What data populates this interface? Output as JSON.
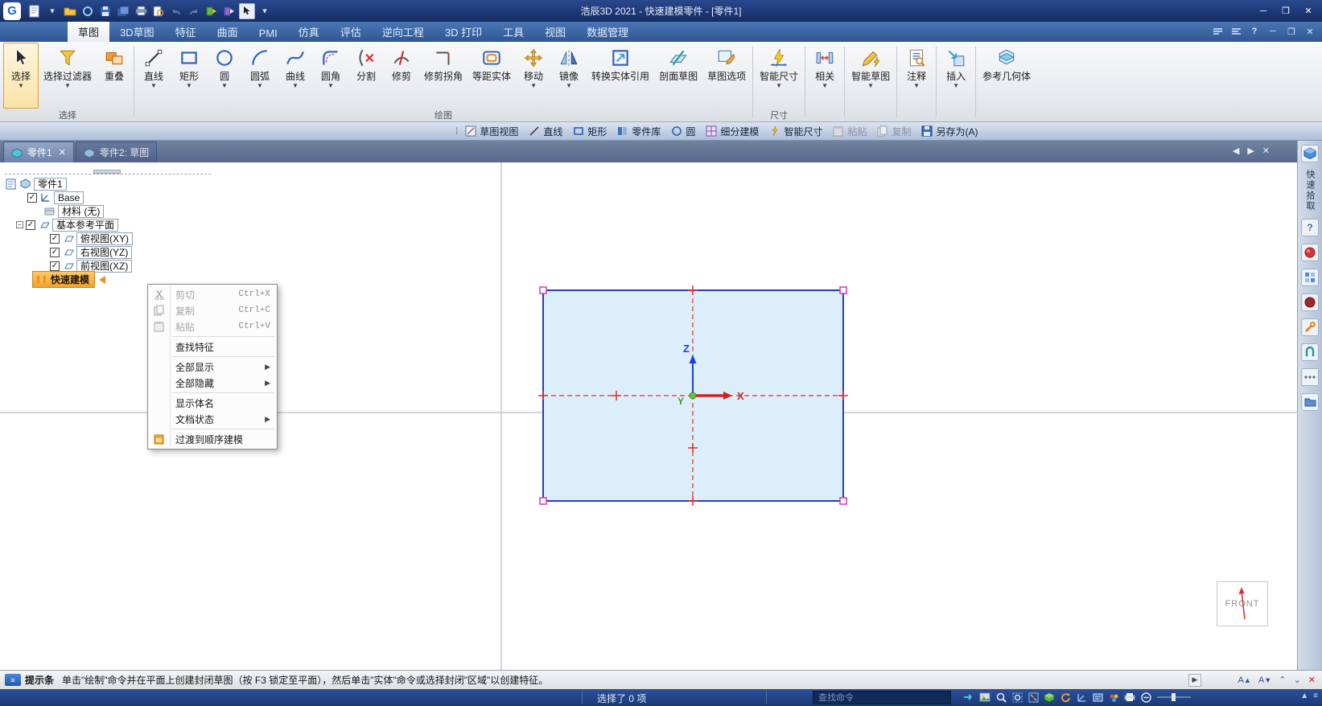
{
  "titlebar": {
    "title": "浩辰3D 2021 - 快速建模零件 - [零件1]"
  },
  "ribbon_tabs": [
    {
      "label": "草图"
    },
    {
      "label": "3D草图"
    },
    {
      "label": "特征"
    },
    {
      "label": "曲面"
    },
    {
      "label": "PMI"
    },
    {
      "label": "仿真"
    },
    {
      "label": "评估"
    },
    {
      "label": "逆向工程"
    },
    {
      "label": "3D 打印"
    },
    {
      "label": "工具"
    },
    {
      "label": "视图"
    },
    {
      "label": "数据管理"
    }
  ],
  "ribbon": {
    "select_group": {
      "label": "选择",
      "select": "选择",
      "filter": "选择过滤器",
      "overlap": "重叠"
    },
    "draw_group": {
      "label": "绘图",
      "line": "直线",
      "rect": "矩形",
      "circle": "圆",
      "arc": "圆弧",
      "curve": "曲线",
      "fillet": "圆角",
      "split": "分割",
      "trim": "修剪",
      "trim_corner": "修剪拐角",
      "offset": "等距实体",
      "move": "移动",
      "mirror": "镜像",
      "convert": "转换实体引用",
      "section": "剖面草图",
      "options": "草图选项"
    },
    "dimension_group": {
      "label": "尺寸",
      "smart_dim": "智能尺寸"
    },
    "relate": "相关",
    "smart_sketch": "智能草图",
    "annotate": "注释",
    "insert": "插入",
    "ref_geometry": "参考几何体"
  },
  "quick_toolbar": {
    "sketch_view": "草图视图",
    "line": "直线",
    "rect": "矩形",
    "part_library": "零件库",
    "circle": "圆",
    "subdivision": "细分建模",
    "smart_dim": "智能尺寸",
    "paste": "粘贴",
    "copy": "复制",
    "save_as": "另存为(A)"
  },
  "document_tabs": [
    {
      "label": "零件1"
    },
    {
      "label": "零件2: 草图"
    }
  ],
  "feature_tree": {
    "root": "零件1",
    "base": "Base",
    "material": "材料 (无)",
    "ref_planes": "基本参考平面",
    "top_view": "俯视图(XY)",
    "right_view": "右视图(YZ)",
    "front_view": "前视图(XZ)",
    "quick_modeling": "快速建模"
  },
  "context_menu": {
    "cut": "剪切",
    "cut_shortcut": "Ctrl+X",
    "copy": "复制",
    "copy_shortcut": "Ctrl+C",
    "paste": "粘贴",
    "paste_shortcut": "Ctrl+V",
    "find_feature": "查找特征",
    "show_all": "全部显示",
    "hide_all": "全部隐藏",
    "show_body_name": "显示体名",
    "document_status": "文档状态",
    "transition_ordered": "过渡到顺序建模"
  },
  "canvas": {
    "axis_x": "X",
    "axis_y": "Y",
    "axis_z": "Z",
    "view_indicator": "FRONT"
  },
  "right_panel": {
    "vertical_label": "快速拾取"
  },
  "status_bar": {
    "label": "提示条",
    "message": "单击\"绘制\"命令并在平面上创建封闭草图（按 F3 锁定至平面），然后单击\"实体\"命令或选择封闭\"区域\"以创建特征。"
  },
  "taskbar": {
    "selection_status": "选择了 0 项",
    "search_placeholder": "查找命令"
  },
  "colors": {
    "accent_orange": "#f1a32e",
    "sketch_fill": "#ddeefb",
    "sketch_stroke": "#2b3bc4",
    "handle_magenta": "#d837b4",
    "centerline_red": "#e03030",
    "titlebar_blue": "#142c63"
  }
}
